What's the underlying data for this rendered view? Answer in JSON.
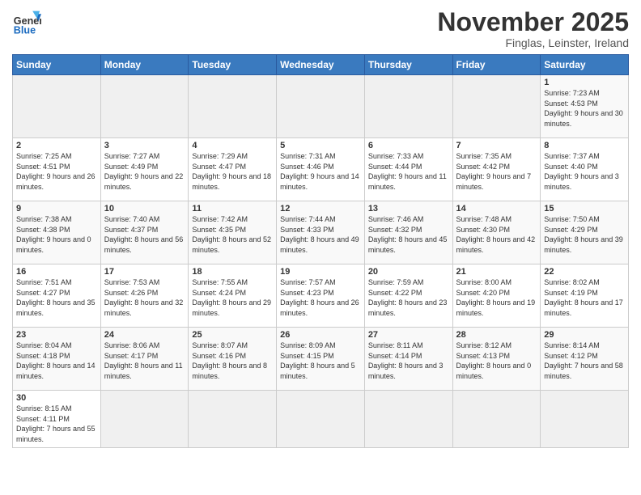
{
  "logo": {
    "text_general": "General",
    "text_blue": "Blue"
  },
  "title": "November 2025",
  "subtitle": "Finglas, Leinster, Ireland",
  "weekdays": [
    "Sunday",
    "Monday",
    "Tuesday",
    "Wednesday",
    "Thursday",
    "Friday",
    "Saturday"
  ],
  "weeks": [
    [
      {
        "day": "",
        "info": ""
      },
      {
        "day": "",
        "info": ""
      },
      {
        "day": "",
        "info": ""
      },
      {
        "day": "",
        "info": ""
      },
      {
        "day": "",
        "info": ""
      },
      {
        "day": "",
        "info": ""
      },
      {
        "day": "1",
        "info": "Sunrise: 7:23 AM\nSunset: 4:53 PM\nDaylight: 9 hours and 30 minutes."
      }
    ],
    [
      {
        "day": "2",
        "info": "Sunrise: 7:25 AM\nSunset: 4:51 PM\nDaylight: 9 hours and 26 minutes."
      },
      {
        "day": "3",
        "info": "Sunrise: 7:27 AM\nSunset: 4:49 PM\nDaylight: 9 hours and 22 minutes."
      },
      {
        "day": "4",
        "info": "Sunrise: 7:29 AM\nSunset: 4:47 PM\nDaylight: 9 hours and 18 minutes."
      },
      {
        "day": "5",
        "info": "Sunrise: 7:31 AM\nSunset: 4:46 PM\nDaylight: 9 hours and 14 minutes."
      },
      {
        "day": "6",
        "info": "Sunrise: 7:33 AM\nSunset: 4:44 PM\nDaylight: 9 hours and 11 minutes."
      },
      {
        "day": "7",
        "info": "Sunrise: 7:35 AM\nSunset: 4:42 PM\nDaylight: 9 hours and 7 minutes."
      },
      {
        "day": "8",
        "info": "Sunrise: 7:37 AM\nSunset: 4:40 PM\nDaylight: 9 hours and 3 minutes."
      }
    ],
    [
      {
        "day": "9",
        "info": "Sunrise: 7:38 AM\nSunset: 4:38 PM\nDaylight: 9 hours and 0 minutes."
      },
      {
        "day": "10",
        "info": "Sunrise: 7:40 AM\nSunset: 4:37 PM\nDaylight: 8 hours and 56 minutes."
      },
      {
        "day": "11",
        "info": "Sunrise: 7:42 AM\nSunset: 4:35 PM\nDaylight: 8 hours and 52 minutes."
      },
      {
        "day": "12",
        "info": "Sunrise: 7:44 AM\nSunset: 4:33 PM\nDaylight: 8 hours and 49 minutes."
      },
      {
        "day": "13",
        "info": "Sunrise: 7:46 AM\nSunset: 4:32 PM\nDaylight: 8 hours and 45 minutes."
      },
      {
        "day": "14",
        "info": "Sunrise: 7:48 AM\nSunset: 4:30 PM\nDaylight: 8 hours and 42 minutes."
      },
      {
        "day": "15",
        "info": "Sunrise: 7:50 AM\nSunset: 4:29 PM\nDaylight: 8 hours and 39 minutes."
      }
    ],
    [
      {
        "day": "16",
        "info": "Sunrise: 7:51 AM\nSunset: 4:27 PM\nDaylight: 8 hours and 35 minutes."
      },
      {
        "day": "17",
        "info": "Sunrise: 7:53 AM\nSunset: 4:26 PM\nDaylight: 8 hours and 32 minutes."
      },
      {
        "day": "18",
        "info": "Sunrise: 7:55 AM\nSunset: 4:24 PM\nDaylight: 8 hours and 29 minutes."
      },
      {
        "day": "19",
        "info": "Sunrise: 7:57 AM\nSunset: 4:23 PM\nDaylight: 8 hours and 26 minutes."
      },
      {
        "day": "20",
        "info": "Sunrise: 7:59 AM\nSunset: 4:22 PM\nDaylight: 8 hours and 23 minutes."
      },
      {
        "day": "21",
        "info": "Sunrise: 8:00 AM\nSunset: 4:20 PM\nDaylight: 8 hours and 19 minutes."
      },
      {
        "day": "22",
        "info": "Sunrise: 8:02 AM\nSunset: 4:19 PM\nDaylight: 8 hours and 17 minutes."
      }
    ],
    [
      {
        "day": "23",
        "info": "Sunrise: 8:04 AM\nSunset: 4:18 PM\nDaylight: 8 hours and 14 minutes."
      },
      {
        "day": "24",
        "info": "Sunrise: 8:06 AM\nSunset: 4:17 PM\nDaylight: 8 hours and 11 minutes."
      },
      {
        "day": "25",
        "info": "Sunrise: 8:07 AM\nSunset: 4:16 PM\nDaylight: 8 hours and 8 minutes."
      },
      {
        "day": "26",
        "info": "Sunrise: 8:09 AM\nSunset: 4:15 PM\nDaylight: 8 hours and 5 minutes."
      },
      {
        "day": "27",
        "info": "Sunrise: 8:11 AM\nSunset: 4:14 PM\nDaylight: 8 hours and 3 minutes."
      },
      {
        "day": "28",
        "info": "Sunrise: 8:12 AM\nSunset: 4:13 PM\nDaylight: 8 hours and 0 minutes."
      },
      {
        "day": "29",
        "info": "Sunrise: 8:14 AM\nSunset: 4:12 PM\nDaylight: 7 hours and 58 minutes."
      }
    ],
    [
      {
        "day": "30",
        "info": "Sunrise: 8:15 AM\nSunset: 4:11 PM\nDaylight: 7 hours and 55 minutes."
      },
      {
        "day": "",
        "info": ""
      },
      {
        "day": "",
        "info": ""
      },
      {
        "day": "",
        "info": ""
      },
      {
        "day": "",
        "info": ""
      },
      {
        "day": "",
        "info": ""
      },
      {
        "day": "",
        "info": ""
      }
    ]
  ]
}
